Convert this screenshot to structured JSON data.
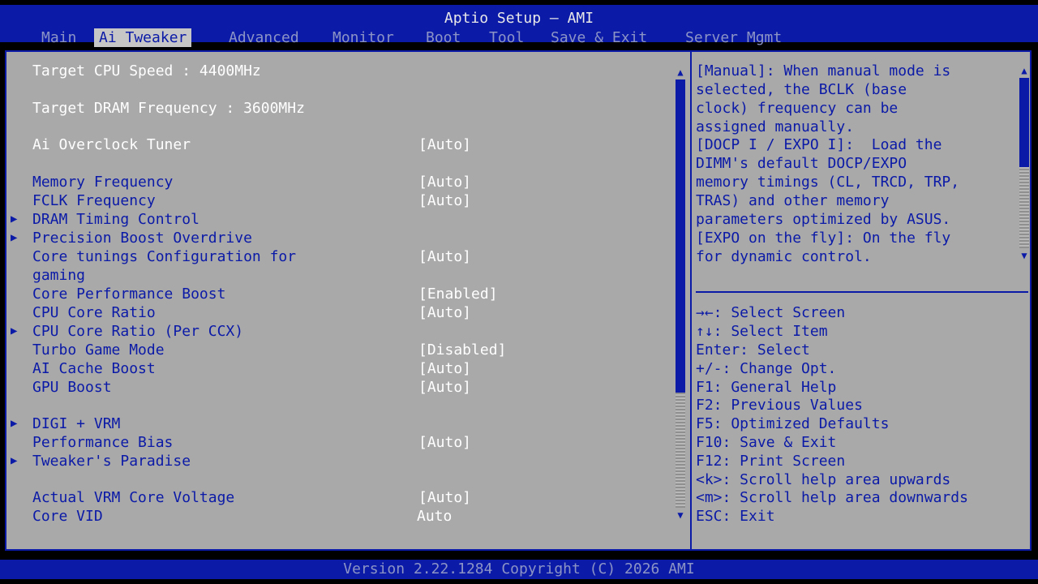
{
  "header": {
    "title": "Aptio Setup – AMI",
    "tabs": [
      {
        "label": "Main"
      },
      {
        "label": "Ai Tweaker"
      },
      {
        "label": "Advanced"
      },
      {
        "label": "Monitor"
      },
      {
        "label": "Boot"
      },
      {
        "label": "Tool"
      },
      {
        "label": "Save & Exit"
      },
      {
        "label": "Server Mgmt"
      }
    ],
    "active_tab": "Ai Tweaker"
  },
  "settings": {
    "info": [
      {
        "label": "Target CPU Speed : 4400MHz"
      },
      {
        "label": "Target DRAM Frequency : 3600MHz"
      }
    ],
    "items": [
      {
        "label": "Ai Overclock Tuner",
        "value": "[Auto]",
        "submenu": false
      },
      {
        "label": "Memory Frequency",
        "value": "[Auto]",
        "submenu": false
      },
      {
        "label": "FCLK Frequency",
        "value": "[Auto]",
        "submenu": false
      },
      {
        "label": "DRAM Timing Control",
        "value": "",
        "submenu": true
      },
      {
        "label": "Precision Boost Overdrive",
        "value": "",
        "submenu": true
      },
      {
        "label": "Core tunings Configuration for",
        "label_line2": "gaming",
        "value": "[Auto]",
        "submenu": false
      },
      {
        "label": "Core Performance Boost",
        "value": "[Enabled]",
        "submenu": false
      },
      {
        "label": "CPU Core Ratio",
        "value": "[Auto]",
        "submenu": false
      },
      {
        "label": "CPU Core Ratio (Per CCX)",
        "value": "",
        "submenu": true
      },
      {
        "label": "Turbo Game Mode",
        "value": "[Disabled]",
        "submenu": false
      },
      {
        "label": "AI Cache Boost",
        "value": "[Auto]",
        "submenu": false
      },
      {
        "label": "GPU Boost",
        "value": "[Auto]",
        "submenu": false
      },
      {
        "label": "DIGI + VRM",
        "value": "",
        "submenu": true
      },
      {
        "label": "Performance Bias",
        "value": "[Auto]",
        "submenu": false
      },
      {
        "label": "Tweaker's Paradise",
        "value": "",
        "submenu": true
      },
      {
        "label": "Actual VRM Core Voltage",
        "value": "[Auto]",
        "submenu": false
      },
      {
        "label": "Core VID",
        "value": "Auto",
        "submenu": false
      }
    ],
    "selected": "Ai Overclock Tuner",
    "scroll_position": 0.0
  },
  "help": {
    "lines": [
      "[Manual]: When manual mode is",
      "selected, the BCLK (base",
      "clock) frequency can be",
      "assigned manually.",
      "[DOCP I / EXPO I]:  Load the",
      "DIMM's default DOCP/EXPO",
      "memory timings (CL, TRCD, TRP,",
      "TRAS) and other memory",
      "parameters optimized by ASUS.",
      "[EXPO on the fly]: On the fly",
      "for dynamic control."
    ],
    "keys": [
      "→←: Select Screen",
      "↑↓: Select Item",
      "Enter: Select",
      "+/-: Change Opt.",
      "F1: General Help",
      "F2: Previous Values",
      "F5: Optimized Defaults",
      "F10: Save & Exit",
      "F12: Print Screen",
      "<k>: Scroll help area upwards",
      "<m>: Scroll help area downwards",
      "ESC: Exit"
    ]
  },
  "footer": {
    "text": "Version 2.22.1284 Copyright (C) 2026 AMI"
  },
  "colors": {
    "bios_blue": "#0b1aa7",
    "panel_gray": "#a9a9a9",
    "text_white": "#ffffff",
    "tab_inactive": "#8c94c6"
  }
}
